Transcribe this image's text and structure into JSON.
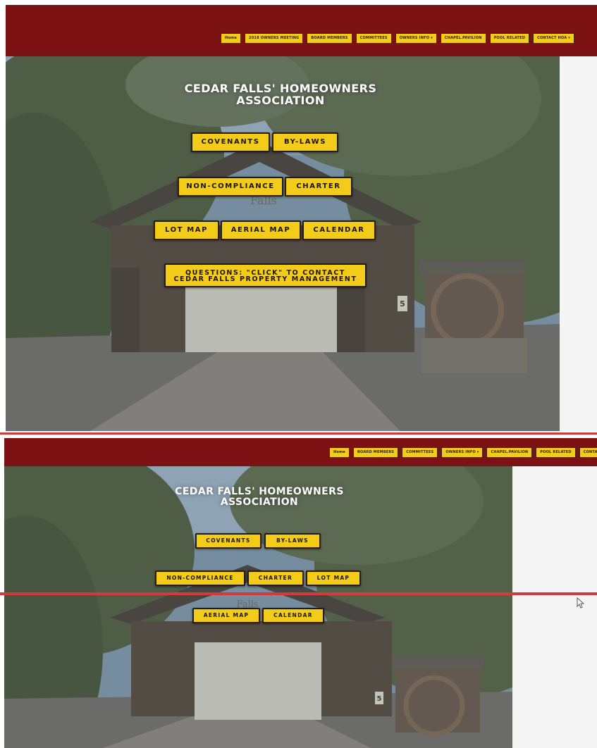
{
  "screenshot_top": {
    "nav_items": [
      "Home",
      "2018 OWNERS MEETING",
      "BOARD MEMBERS",
      "COMMITTEES",
      "OWNERS INFO ▾",
      "CHAPEL.PAVILION",
      "POOL RELATED",
      "CONTACT HOA ▾"
    ],
    "hero_title_line1": "CEDAR FALLS' HOMEOWNERS",
    "hero_title_line2": "ASSOCIATION",
    "buttons": {
      "covenants": "COVENANTS",
      "bylaws": "BY-LAWS",
      "noncompliance": "NON-COMPLIANCE",
      "charter": "CHARTER",
      "lotmap": "LOT MAP",
      "aerialmap": "AERIAL MAP",
      "calendar": "CALENDAR",
      "questions_line1": "QUESTIONS: \"CLICK\" to CONTACT",
      "questions_line2": "CEDAR FALLS PROPERTY MANAGEMENT"
    },
    "sign_text": "Falls",
    "speed_sign": "5"
  },
  "screenshot_bottom": {
    "nav_items": [
      "Home",
      "BOARD MEMBERS",
      "COMMITTEES",
      "OWNERS INFO ▾",
      "CHAPEL.PAVILION",
      "POOL RELATED",
      "CONTACT HOA ▾"
    ],
    "hero_title_line1": "CEDAR FALLS' HOMEOWNERS",
    "hero_title_line2": "ASSOCIATION",
    "buttons": {
      "covenants": "COVENANTS",
      "bylaws": "BY-LAWS",
      "noncompliance": "NON-COMPLIANCE",
      "charter": "CHARTER",
      "lotmap": "LOT MAP",
      "aerialmap": "AERIAL MAP",
      "calendar": "CALENDAR"
    },
    "sign_text": "Falls",
    "speed_sign": "5"
  },
  "colors": {
    "nav_background": "#7d1214",
    "button_yellow": "#f3cc1a",
    "divider_red": "#d33a3a"
  }
}
